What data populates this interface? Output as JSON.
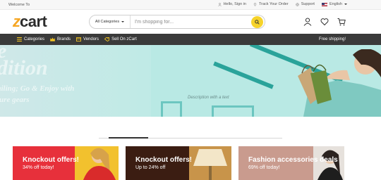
{
  "topbar": {
    "welcome": "Welcome To",
    "login": "Hello, Sign in",
    "track": "Track Your Order",
    "support": "Support",
    "language": "English"
  },
  "header": {
    "logo_z": "z",
    "logo_cart": "cart",
    "category_select": "All Categories",
    "search_placeholder": "I'm shopping for..."
  },
  "nav": {
    "items": [
      {
        "label": "Categories",
        "icon": "menu-icon"
      },
      {
        "label": "Brands",
        "icon": "crown-icon"
      },
      {
        "label": "Vendors",
        "icon": "store-icon"
      },
      {
        "label": "Sell On zCart",
        "icon": "sell-icon"
      }
    ],
    "free_shipping": "Free shipping!"
  },
  "hero": {
    "line1": "e",
    "line2": "dition",
    "line3": "ailing; Go & Enjoy with",
    "line4": "ture gears",
    "caption": "Description with a text"
  },
  "promos": [
    {
      "title": "Knockout offers!",
      "subtitle": "34% off today!",
      "color": "#e7303b"
    },
    {
      "title": "Knockout offers!",
      "subtitle": "Up to 24% off",
      "color": "#3b1d12"
    },
    {
      "title": "Fashion accessories deals",
      "subtitle": "69% off today!",
      "color": "#c99b8e"
    }
  ],
  "colors": {
    "accent": "#f6a623",
    "search_button": "#f6d32a",
    "nav_bg": "#3a3a3a",
    "hero_teal": "#2aa39a"
  }
}
